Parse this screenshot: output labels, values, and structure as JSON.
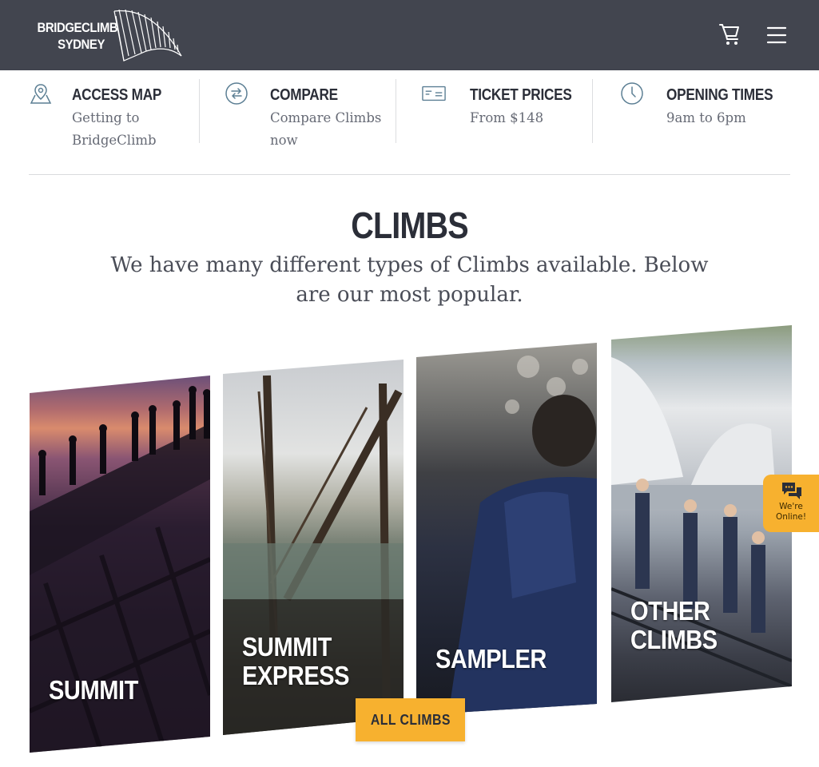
{
  "header": {
    "logo_line1": "BRIDGECLIMB",
    "logo_line2": "SYDNEY",
    "cart_icon": "cart-icon",
    "menu_icon": "hamburger-menu-icon",
    "bg_color": "#42454f"
  },
  "info": [
    {
      "icon": "map-pin-icon",
      "title": "ACCESS MAP",
      "sub": "Getting to BridgeClimb"
    },
    {
      "icon": "compare-arrows-icon",
      "title": "COMPARE",
      "sub": "Compare Climbs now"
    },
    {
      "icon": "ticket-icon",
      "title": "TICKET PRICES",
      "sub": "From $148"
    },
    {
      "icon": "clock-icon",
      "title": "OPENING TIMES",
      "sub": "9am to 6pm"
    }
  ],
  "climbs": {
    "title": "CLIMBS",
    "subtitle": "We have many different types of Climbs available. Below are our most popular.",
    "cards": [
      {
        "label": "SUMMIT"
      },
      {
        "label": "SUMMIT\nEXPRESS"
      },
      {
        "label": "SAMPLER"
      },
      {
        "label": "OTHER\nCLIMBS"
      }
    ],
    "button": "ALL CLIMBS",
    "accent_color": "#f7b12f"
  },
  "chat": {
    "icon": "chat-bubbles-icon",
    "line1": "We're",
    "line2": "Online!"
  }
}
